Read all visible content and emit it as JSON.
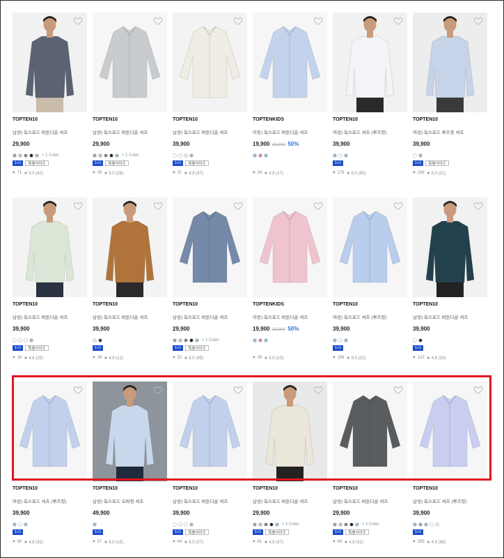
{
  "colors": {
    "highlight": "#e3161e",
    "tag_primary": "#1d4ec9",
    "discount": "#2f6fdc"
  },
  "rows": [
    {
      "products": [
        {
          "image": "person-plaid-shirt",
          "bg": "#f1f1f1",
          "brand": "TOPTEN10",
          "name": "남성) 옥스포드 버튼다운 셔츠",
          "price": "29,900",
          "original_price": "",
          "discount": "",
          "swatches": [
            "#9a9a9a",
            "#bfbfbf",
            "#7d7d7d",
            "#111111",
            "#8fb8d8"
          ],
          "more_colors": "+ 1 Color",
          "tags": [
            "1+1",
            "특별사이즈"
          ],
          "likes": "71",
          "rating": "★ 5.0 (42)"
        },
        {
          "image": "plaid-shirt",
          "bg": "#f6f6f6",
          "brand": "TOPTEN10",
          "name": "남성) 옥스포드 버튼다운 셔츠",
          "price": "29,900",
          "original_price": "",
          "discount": "",
          "swatches": [
            "#9a9a9a",
            "#bfbfbf",
            "#7d7d7d",
            "#111111",
            "#8fb8d8"
          ],
          "more_colors": "+ 1 Color",
          "tags": [
            "1+1",
            "특별사이즈"
          ],
          "likes": "39",
          "rating": "★ 5.0 (28)"
        },
        {
          "image": "ivory-shirt",
          "bg": "#f3f3f3",
          "brand": "TOPTEN10",
          "name": "남성) 옥스포드 버튼다운 셔츠",
          "price": "39,900",
          "original_price": "",
          "discount": "",
          "swatches": [
            "#ffffff",
            "#ffffff",
            "#e9e6dc",
            "#8fb8d8"
          ],
          "more_colors": "",
          "tags": [
            "1+1",
            "특별사이즈"
          ],
          "likes": "37",
          "rating": "★ 4.9 (37)"
        },
        {
          "image": "blue-shirt",
          "bg": "#f6f6f6",
          "brand": "TOPTENKIDS",
          "name": "아동) 옥스포드 버튼다운 셔츠",
          "price": "19,900",
          "original_price": "39,900",
          "discount": "50%",
          "swatches": [
            "#8fb8d8",
            "#e07aa0",
            "#8fb8d8"
          ],
          "more_colors": "",
          "tags": [],
          "likes": "34",
          "rating": "★ 4.9 (17)"
        },
        {
          "image": "woman-white-shirt",
          "bg": "#f1f1f1",
          "brand": "TOPTEN10",
          "name": "여성) 옥스포드 셔츠 (루즈핏)",
          "price": "39,900",
          "original_price": "",
          "discount": "",
          "swatches": [
            "#8fb8d8",
            "#ffffff",
            "#8fb8d8"
          ],
          "more_colors": "",
          "tags": [
            "1+1"
          ],
          "likes": "178",
          "rating": "★ 5.0 (50)"
        },
        {
          "image": "woman-blue-shirt",
          "bg": "#ededed",
          "brand": "TOPTEN10",
          "name": "여성) 옥스포드 루즈핏 셔츠",
          "price": "39,900",
          "original_price": "",
          "discount": "",
          "swatches": [
            "#ffffff",
            "#8fb8d8"
          ],
          "more_colors": "",
          "tags": [
            "1+1",
            "특별사이즈"
          ],
          "likes": "249",
          "rating": "★ 5.0 (21)"
        }
      ]
    },
    {
      "products": [
        {
          "image": "man-mint-shirt",
          "bg": "#f3f3f3",
          "brand": "TOPTEN10",
          "name": "남성) 옥스포드 버튼다운 셔츠",
          "price": "39,900",
          "original_price": "",
          "discount": "",
          "swatches": [
            "#ffffff",
            "#ffffff",
            "#ffffff",
            "#8fb8d8"
          ],
          "more_colors": "",
          "tags": [
            "1+1",
            "특별사이즈"
          ],
          "likes": "16",
          "rating": "★ 4.8 (25)"
        },
        {
          "image": "man-brown-shirt",
          "bg": "#f3f3f3",
          "brand": "TOPTEN10",
          "name": "남성) 옥스포드 버튼다운 셔츠",
          "price": "39,900",
          "original_price": "",
          "discount": "",
          "swatches": [
            "#e9e6dc",
            "#333333"
          ],
          "more_colors": "",
          "tags": [
            "1+1"
          ],
          "likes": "39",
          "rating": "★ 4.9 (12)"
        },
        {
          "image": "navy-blue-shirt",
          "bg": "#f6f6f6",
          "brand": "TOPTEN10",
          "name": "남성) 옥스포드 버튼다운 셔츠",
          "price": "29,900",
          "original_price": "",
          "discount": "",
          "swatches": [
            "#9a9a9a",
            "#bfbfbf",
            "#7d7d7d",
            "#111111",
            "#8fb8d8"
          ],
          "more_colors": "+ 1 Color",
          "tags": [
            "1+1",
            "특별사이즈"
          ],
          "likes": "52",
          "rating": "★ 5.0 (45)"
        },
        {
          "image": "pink-shirt",
          "bg": "#f6f6f6",
          "brand": "TOPTENKIDS",
          "name": "아동) 옥스포드 버튼다운 셔츠",
          "price": "19,900",
          "original_price": "39,900",
          "discount": "50%",
          "swatches": [
            "#8fb8d8",
            "#e07aa0",
            "#8fb8d8"
          ],
          "more_colors": "",
          "tags": [],
          "likes": "29",
          "rating": "★ 5.0 (10)"
        },
        {
          "image": "light-blue-shirt",
          "bg": "#f6f6f6",
          "brand": "TOPTEN10",
          "name": "여성) 옥스포드 셔츠 (루즈핏)",
          "price": "39,900",
          "original_price": "",
          "discount": "",
          "swatches": [
            "#8fb8d8",
            "#ffffff",
            "#8fb8d8"
          ],
          "more_colors": "",
          "tags": [
            "1+1"
          ],
          "likes": "106",
          "rating": "★ 5.0 (22)"
        },
        {
          "image": "man-green-shirt",
          "bg": "#f1f1f1",
          "brand": "TOPTEN10",
          "name": "남성) 옥스포드 버튼다운 셔츠",
          "price": "39,900",
          "original_price": "",
          "discount": "",
          "swatches": [
            "#ffffff",
            "#1e2b44"
          ],
          "more_colors": "",
          "tags": [
            "1+1"
          ],
          "likes": "122",
          "rating": "★ 4.8 (20)"
        }
      ]
    },
    {
      "products": [
        {
          "image": "blue-shirt-2",
          "bg": "#f6f6f6",
          "brand": "TOPTEN10",
          "name": "여성) 옥스포드 셔츠 (루즈핏)",
          "price": "39,900",
          "original_price": "",
          "discount": "",
          "swatches": [
            "#8fb8d8",
            "#ffffff",
            "#8fb8d8"
          ],
          "more_colors": "",
          "tags": [
            "1+1"
          ],
          "likes": "90",
          "rating": "★ 4.8 (32)"
        },
        {
          "image": "man-striped-shirt",
          "bg": "#8e949b",
          "brand": "TOPTEN10",
          "name": "남성) 옥스포드 오버핏 셔츠",
          "price": "49,900",
          "original_price": "",
          "discount": "",
          "swatches": [
            "#8fb8d8"
          ],
          "more_colors": "",
          "tags": [
            "1+1"
          ],
          "likes": "57",
          "rating": "★ 5.0 (15)"
        },
        {
          "image": "blue-shirt-3",
          "bg": "#f6f6f6",
          "brand": "TOPTEN10",
          "name": "남성) 옥스포드 버튼다운 셔츠",
          "price": "39,900",
          "original_price": "",
          "discount": "",
          "swatches": [
            "#ffffff",
            "#ffffff",
            "#ffffff",
            "#8fb8d8"
          ],
          "more_colors": "",
          "tags": [
            "1+1",
            "특별사이즈"
          ],
          "likes": "44",
          "rating": "★ 5.0 (27)"
        },
        {
          "image": "man-ivory-shirt",
          "bg": "#e9e9e9",
          "brand": "TOPTEN10",
          "name": "남성) 옥스포드 버튼다운 셔츠",
          "price": "29,900",
          "original_price": "",
          "discount": "",
          "swatches": [
            "#9a9a9a",
            "#bfbfbf",
            "#7d7d7d",
            "#111111",
            "#8fb8d8"
          ],
          "more_colors": "+ 1 Color",
          "tags": [
            "1+1",
            "특별사이즈"
          ],
          "likes": "61",
          "rating": "★ 4.9 (37)"
        },
        {
          "image": "gray-shirt",
          "bg": "#f6f6f6",
          "brand": "TOPTEN10",
          "name": "남성) 옥스포드 버튼다운 셔츠",
          "price": "29,900",
          "original_price": "",
          "discount": "",
          "swatches": [
            "#9a9a9a",
            "#bfbfbf",
            "#7d7d7d",
            "#111111",
            "#8fb8d8"
          ],
          "more_colors": "+ 1 Color",
          "tags": [
            "1+1",
            "특별사이즈"
          ],
          "likes": "69",
          "rating": "★ 4.9 (31)"
        },
        {
          "image": "lavender-shirt",
          "bg": "#f6f6f6",
          "brand": "TOPTEN10",
          "name": "남성) 옥스포드 셔츠 (루즈핏)",
          "price": "39,900",
          "original_price": "",
          "discount": "",
          "swatches": [
            "#8fb8d8",
            "#9a9a9a",
            "#8fb8d8",
            "#ffffff",
            "#f2efd0"
          ],
          "more_colors": "",
          "tags": [
            "1+1"
          ],
          "likes": "283",
          "rating": "★ 4.9 (68)"
        }
      ]
    }
  ]
}
